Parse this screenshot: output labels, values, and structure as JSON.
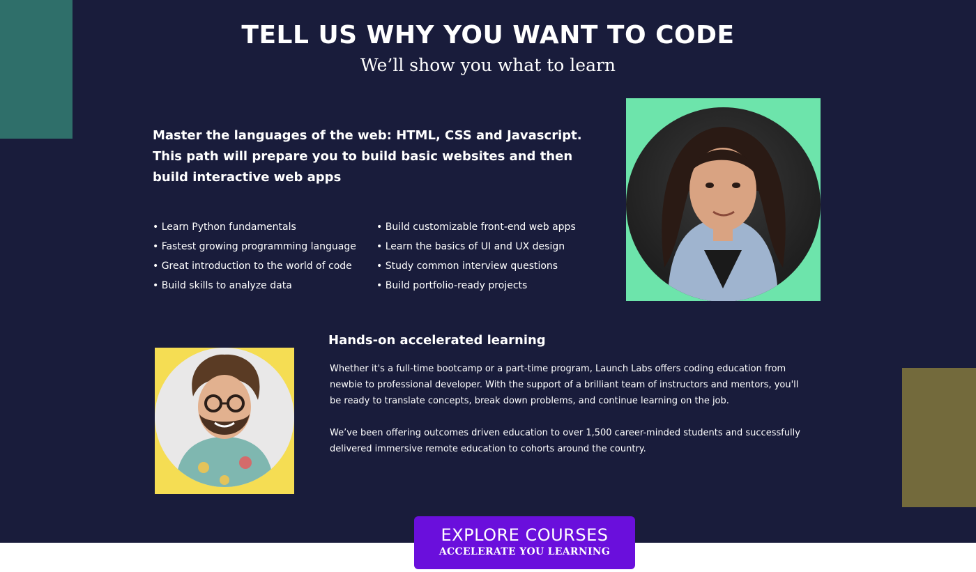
{
  "colors": {
    "background": "#191c3b",
    "accent_teal": "#2f6f6a",
    "accent_olive": "#736a3c",
    "photo_green": "#6de4ab",
    "photo_yellow": "#f5dd53",
    "cta_purple": "#6a0fdc"
  },
  "header": {
    "title": "TELL US WHY YOU WANT TO CODE",
    "subtitle": "We’ll show you what to learn"
  },
  "path": {
    "description": "Master the languages of the web: HTML, CSS and Javascript. This path will prepare you to build basic websites and then build interactive web apps",
    "bullets_left": [
      "• Learn Python fundamentals",
      "• Fastest growing programming language",
      "• Great introduction to the world of code",
      "• Build skills to analyze data"
    ],
    "bullets_right": [
      "• Build customizable front-end web apps",
      "• Learn the basics of UI and UX design",
      "• Study common interview questions",
      "• Build portfolio-ready projects"
    ]
  },
  "learning": {
    "title": "Hands-on accelerated learning",
    "paragraph1": "Whether it's a full-time bootcamp or a part-time program, Launch Labs offers coding education from newbie to professional developer. With the support of a brilliant team of instructors and mentors, you'll be ready to translate concepts, break down problems, and continue learning on the job.",
    "paragraph2": "We’ve been offering outcomes driven education to over 1,500 career-minded students and successfully delivered immersive remote education to cohorts around the country."
  },
  "cta": {
    "label": "EXPLORE COURSES",
    "sublabel": "ACCELERATE YOU LEARNING"
  }
}
